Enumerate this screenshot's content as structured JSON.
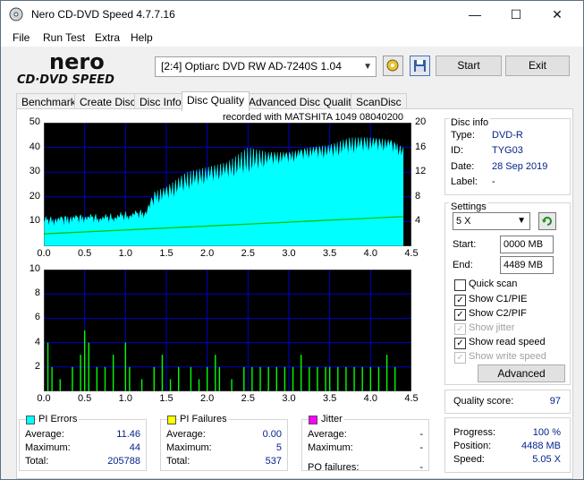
{
  "window": {
    "title": "Nero CD-DVD Speed 4.7.7.16",
    "minimize": "—",
    "maximize": "☐",
    "close": "✕"
  },
  "menu": [
    "File",
    "Run Test",
    "Extra",
    "Help"
  ],
  "toolbar": {
    "drive": "[2:4]   Optiarc DVD RW AD-7240S 1.04",
    "start_label": "Start",
    "exit_label": "Exit"
  },
  "tabs": [
    "Benchmark",
    "Create Disc",
    "Disc Info",
    "Disc Quality",
    "Advanced Disc Quality",
    "ScanDisc"
  ],
  "active_tab": "Disc Quality",
  "recorded_with": "recorded with MATSHITA 1049 08040200",
  "disc_info": {
    "title": "Disc info",
    "type_label": "Type:",
    "type": "DVD-R",
    "id_label": "ID:",
    "id": "TYG03",
    "date_label": "Date:",
    "date": "28 Sep 2019",
    "label_label": "Label:",
    "label": "-"
  },
  "settings": {
    "title": "Settings",
    "speed": "5 X",
    "start_label": "Start:",
    "start": "0000 MB",
    "end_label": "End:",
    "end": "4489 MB",
    "quick_scan": "Quick scan",
    "show_c1pie": "Show C1/PIE",
    "show_c2pif": "Show C2/PIF",
    "show_jitter": "Show jitter",
    "show_read_speed": "Show read speed",
    "show_write_speed": "Show write speed",
    "advanced": "Advanced"
  },
  "quality": {
    "label": "Quality score:",
    "value": "97"
  },
  "progress": {
    "progress_label": "Progress:",
    "progress": "100 %",
    "position_label": "Position:",
    "position": "4488 MB",
    "speed_label": "Speed:",
    "speed": "5.05 X"
  },
  "stats": {
    "pi_errors": {
      "title": "PI Errors",
      "avg_label": "Average:",
      "avg": "11.46",
      "max_label": "Maximum:",
      "max": "44",
      "total_label": "Total:",
      "total": "205788"
    },
    "pi_failures": {
      "title": "PI Failures",
      "avg_label": "Average:",
      "avg": "0.00",
      "max_label": "Maximum:",
      "max": "5",
      "total_label": "Total:",
      "total": "537"
    },
    "jitter": {
      "title": "Jitter",
      "avg_label": "Average:",
      "avg": "-",
      "max_label": "Maximum:",
      "max": "-",
      "po_label": "PO failures:",
      "po": "-"
    }
  },
  "colors": {
    "pie": "#00ffff",
    "pif": "#ffff00",
    "jitter": "#ff00ff",
    "read_speed": "#00c800",
    "plot_bg": "#000000",
    "grid": "#0000c8",
    "bar_green": "#00ff00"
  },
  "chart_data": [
    {
      "type": "area",
      "name": "PI Errors",
      "x_ticks": [
        "0.0",
        "0.5",
        "1.0",
        "1.5",
        "2.0",
        "2.5",
        "3.0",
        "3.5",
        "4.0",
        "4.5"
      ],
      "y_ticks_left": [
        "10",
        "20",
        "30",
        "40",
        "50"
      ],
      "y_ticks_right": [
        "4",
        "8",
        "12",
        "16",
        "20"
      ],
      "xlim": [
        0,
        4.5
      ],
      "ylim": [
        0,
        50
      ],
      "y2lim": [
        0,
        20
      ],
      "grid": true,
      "x": [
        0.0,
        0.25,
        0.5,
        0.75,
        1.0,
        1.25,
        1.35,
        1.5,
        1.75,
        2.0,
        2.25,
        2.5,
        2.75,
        3.0,
        3.25,
        3.5,
        3.75,
        4.0,
        4.25,
        4.4
      ],
      "values": [
        8,
        8,
        9,
        9,
        10,
        11,
        16,
        18,
        22,
        25,
        27,
        29,
        32,
        33,
        35,
        35,
        37,
        38,
        38,
        35
      ],
      "peaks": [
        10,
        12,
        12,
        11,
        12,
        14,
        22,
        24,
        30,
        32,
        34,
        40,
        38,
        38,
        40,
        41,
        44,
        44,
        43,
        40
      ],
      "read_speed": {
        "x": [
          0.0,
          4.4
        ],
        "values": [
          2.0,
          4.8
        ]
      }
    },
    {
      "type": "bar",
      "name": "PI Failures",
      "x_ticks": [
        "0.0",
        "0.5",
        "1.0",
        "1.5",
        "2.0",
        "2.5",
        "3.0",
        "3.5",
        "4.0",
        "4.5"
      ],
      "y_ticks": [
        "2",
        "4",
        "6",
        "8",
        "10"
      ],
      "xlim": [
        0,
        4.5
      ],
      "ylim": [
        0,
        10
      ],
      "grid": true,
      "x": [
        0.05,
        0.1,
        0.2,
        0.35,
        0.45,
        0.5,
        0.55,
        0.65,
        0.75,
        0.85,
        1.0,
        1.05,
        1.2,
        1.35,
        1.45,
        1.55,
        1.65,
        1.8,
        1.9,
        2.0,
        2.1,
        2.15,
        2.3,
        2.45,
        2.55,
        2.65,
        2.75,
        2.85,
        2.95,
        3.05,
        3.15,
        3.25,
        3.35,
        3.45,
        3.5,
        3.6,
        3.7,
        3.8,
        3.9,
        4.0,
        4.1,
        4.2,
        4.3
      ],
      "values": [
        4,
        2,
        1,
        2,
        3,
        5,
        4,
        2,
        2,
        3,
        4,
        2,
        1,
        2,
        3,
        1,
        2,
        2,
        1,
        2,
        3,
        2,
        1,
        2,
        2,
        2,
        2,
        2,
        2,
        2,
        3,
        2,
        2,
        2,
        2,
        2,
        2,
        2,
        2,
        2,
        2,
        3,
        2
      ]
    }
  ]
}
